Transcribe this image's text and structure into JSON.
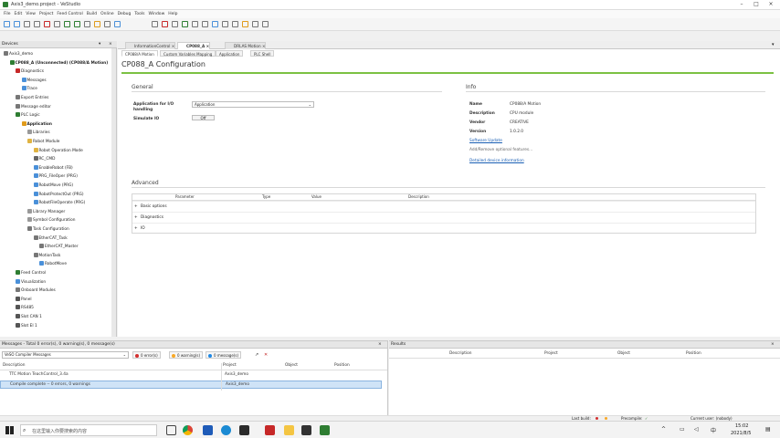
{
  "window": {
    "title": "Axis3_demo.project - VeStudio"
  },
  "menu": [
    "File",
    "Edit",
    "View",
    "Project",
    "Feed Control",
    "Build",
    "Online",
    "Debug",
    "Tools",
    "Window",
    "Help"
  ],
  "devices_panel": {
    "title": "Devices"
  },
  "tree": [
    {
      "label": "Axis3_demo",
      "indent": 0
    },
    {
      "label": "CP088_A (Unconnected) (CP088/A Motion)",
      "indent": 1,
      "bold": true
    },
    {
      "label": "Diagnostics",
      "indent": 2
    },
    {
      "label": "Messages",
      "indent": 3
    },
    {
      "label": "Trace",
      "indent": 3
    },
    {
      "label": "Export Entries",
      "indent": 2
    },
    {
      "label": "Message editor",
      "indent": 2
    },
    {
      "label": "PLC Logic",
      "indent": 2
    },
    {
      "label": "Application",
      "indent": 3,
      "bold": true
    },
    {
      "label": "Libraries",
      "indent": 4
    },
    {
      "label": "Robot Module",
      "indent": 4
    },
    {
      "label": "Robot Operation Mode",
      "indent": 5
    },
    {
      "label": "RC_CMD",
      "indent": 5
    },
    {
      "label": "EnableRobot (FB)",
      "indent": 5
    },
    {
      "label": "PRG_FileOper (PRG)",
      "indent": 5
    },
    {
      "label": "RobotMove (PRG)",
      "indent": 5
    },
    {
      "label": "RobotProtectOut (PRG)",
      "indent": 5
    },
    {
      "label": "RobotFileOperate (PRG)",
      "indent": 5
    },
    {
      "label": "Library Manager",
      "indent": 4
    },
    {
      "label": "Symbol Configuration",
      "indent": 4
    },
    {
      "label": "Task Configuration",
      "indent": 4
    },
    {
      "label": "EtherCAT_Task",
      "indent": 5
    },
    {
      "label": "EtherCAT_Master",
      "indent": 6
    },
    {
      "label": "MotionTask",
      "indent": 5
    },
    {
      "label": "RobotMove",
      "indent": 6
    },
    {
      "label": "Feed Control",
      "indent": 2
    },
    {
      "label": "Visualization",
      "indent": 2
    },
    {
      "label": "Onboard Modules",
      "indent": 2
    },
    {
      "label": "Panel",
      "indent": 2
    },
    {
      "label": "RS485",
      "indent": 2
    },
    {
      "label": "Slot CAN 1",
      "indent": 2
    },
    {
      "label": "Slot EI 1",
      "indent": 2
    }
  ],
  "tabs": [
    {
      "label": "InformationControl",
      "active": false
    },
    {
      "label": "CP088_A",
      "active": true
    },
    {
      "label": "DRLAS Motion",
      "active": false
    }
  ],
  "subtabs": [
    {
      "label": "CP088/A Motion",
      "active": true
    },
    {
      "label": "Custom Variables Mapping",
      "active": false
    },
    {
      "label": "Application",
      "active": false
    },
    {
      "label": "PLC Shell",
      "active": false
    }
  ],
  "config": {
    "title": "CP088_A Configuration",
    "general_title": "General",
    "app_label": "Application for I/O handling",
    "app_value": "Application",
    "simulate_label": "Simulate IO",
    "simulate_value": "Off",
    "info_title": "Info",
    "info": [
      {
        "key": "Name",
        "value": "CP088/A Motion"
      },
      {
        "key": "Description",
        "value": "CPU module"
      },
      {
        "key": "Vendor",
        "value": "CREATIVE"
      },
      {
        "key": "Version",
        "value": "1.0.2.0"
      }
    ],
    "links": [
      "Software Update",
      "Add/Remove optional features...",
      "Detailed device information"
    ],
    "advanced_title": "Advanced",
    "grid_headers": [
      "Parameter",
      "Type",
      "Value",
      "Description"
    ],
    "grid_rows": [
      "Basic options",
      "Diagnostics",
      "IO"
    ]
  },
  "messages": {
    "header": "Messages - Total 0 error(s), 0 warning(s), 0 message(s)",
    "source": "VeSO Compiler Messages",
    "errors": "0 error(s)",
    "warnings": "0 warning(s)",
    "msgs": "0 message(s)",
    "cols": [
      "Description",
      "Project",
      "Object",
      "Position"
    ],
    "rows": [
      {
        "desc": "TTC Motion TeachControl_3.4a",
        "project": "Axis3_demo",
        "object": "",
        "position": ""
      },
      {
        "desc": "Compile complete -- 0 errors, 0 warnings",
        "project": "Axis3_demo",
        "object": "",
        "position": "",
        "selected": true
      }
    ]
  },
  "results": {
    "title": "Results",
    "cols": [
      "Description",
      "Project",
      "Object",
      "Position"
    ]
  },
  "status": {
    "last_build": "Last build:",
    "precompile": "Precompile:",
    "user": "Current user: (nobody)"
  },
  "taskbar": {
    "search": "在这里输入你要搜索的内容",
    "time": "15:02",
    "date": "2021/8/5"
  },
  "colors": {
    "accent": "#7bc143",
    "link": "#1a5fb4",
    "selection": "#cfe3f7"
  }
}
